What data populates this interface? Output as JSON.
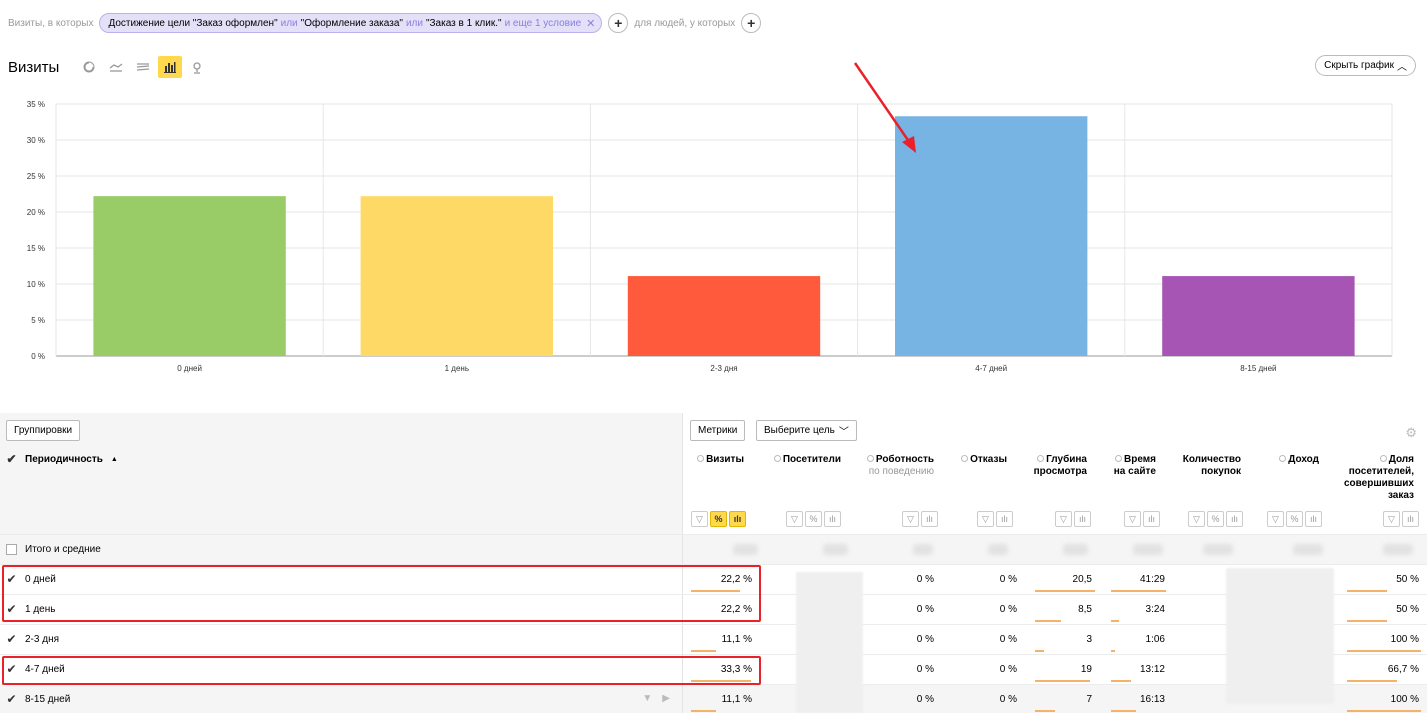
{
  "filter": {
    "prefix": "Визиты, в которых",
    "cond1": "Достижение цели \"Заказ оформлен\"",
    "or1": "или",
    "cond2": "\"Оформление заказа\"",
    "or2": "или",
    "cond3": "\"Заказ в 1 клик.\"",
    "more": "и еще 1 условие",
    "people": "для людей, у которых"
  },
  "report": {
    "title": "Визиты",
    "hide_chart": "Скрыть график",
    "view_icons": [
      "pie-chart-icon",
      "line-chart-icon",
      "stacked-area-icon",
      "bar-chart-icon",
      "map-pin-icon"
    ]
  },
  "chart_data": {
    "type": "bar",
    "categories": [
      "0 дней",
      "1 день",
      "2-3 дня",
      "4-7 дней",
      "8-15 дней"
    ],
    "values": [
      22.2,
      22.2,
      11.1,
      33.3,
      11.1
    ],
    "colors": [
      "#99cc66",
      "#ffd966",
      "#ff5a3c",
      "#77b4e4",
      "#a655b5"
    ],
    "yticks": [
      "0 %",
      "5 %",
      "10 %",
      "15 %",
      "20 %",
      "25 %",
      "30 %",
      "35 %"
    ],
    "ylim": [
      0,
      35
    ],
    "grid": true
  },
  "table": {
    "groupings_label": "Группировки",
    "metrics_label": "Метрики",
    "goal_label": "Выберите цель",
    "dimension_header": "Периодичность",
    "columns": [
      {
        "name": "Визиты"
      },
      {
        "name": "Посетители"
      },
      {
        "name": "Роботность",
        "sub": "по поведению"
      },
      {
        "name": "Отказы"
      },
      {
        "name": "Глубина",
        "name2": "просмотра"
      },
      {
        "name": "Время",
        "name2": "на сайте"
      },
      {
        "name": "Количество",
        "name2": "покупок"
      },
      {
        "name": "Доход"
      },
      {
        "name": "Доля",
        "name2": "посетителей,",
        "name3": "совершивших",
        "name4": "заказ"
      }
    ],
    "total_label": "Итого и средние",
    "rows": [
      {
        "label": "0 дней",
        "visits": "22,2 %",
        "robot": "0 %",
        "bounce": "0 %",
        "depth": "20,5",
        "time": "41:29",
        "share": "50 %"
      },
      {
        "label": "1 день",
        "visits": "22,2 %",
        "robot": "0 %",
        "bounce": "0 %",
        "depth": "8,5",
        "time": "3:24",
        "share": "50 %"
      },
      {
        "label": "2-3 дня",
        "visits": "11,1 %",
        "robot": "0 %",
        "bounce": "0 %",
        "depth": "3",
        "time": "1:06",
        "share": "100 %"
      },
      {
        "label": "4-7 дней",
        "visits": "33,3 %",
        "robot": "0 %",
        "bounce": "0 %",
        "depth": "19",
        "time": "13:12",
        "share": "66,7 %"
      },
      {
        "label": "8-15 дней",
        "visits": "11,1 %",
        "robot": "0 %",
        "bounce": "0 %",
        "depth": "7",
        "time": "16:13",
        "share": "100 %"
      }
    ]
  }
}
